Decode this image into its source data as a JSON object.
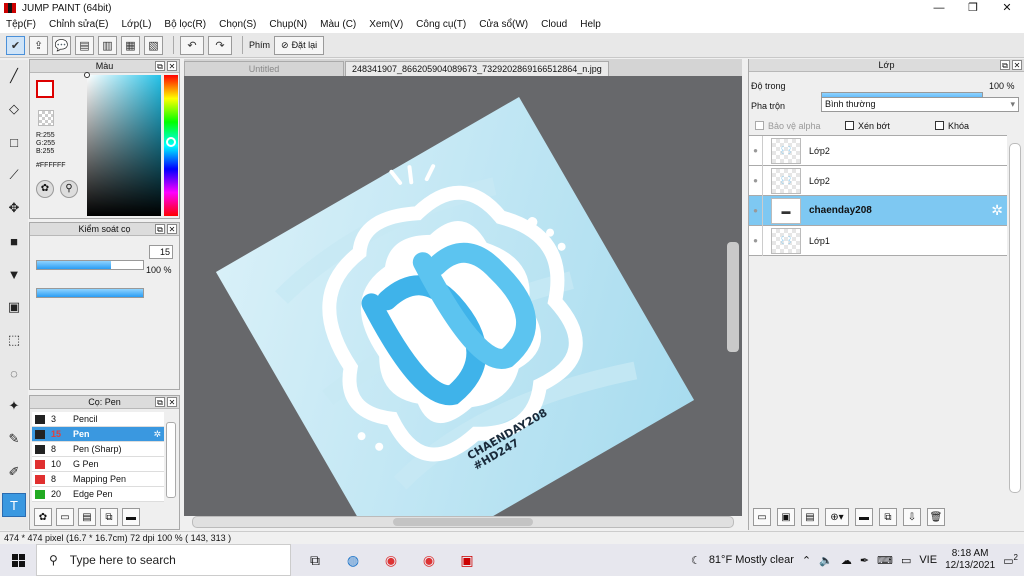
{
  "title": "JUMP PAINT (64bit)",
  "window_controls": {
    "minimize": "—",
    "maximize": "❐",
    "close": "✕"
  },
  "menu": [
    "Tệp(F)",
    "Chỉnh sửa(E)",
    "Lớp(L)",
    "Bộ lọc(R)",
    "Chọn(S)",
    "Chụp(N)",
    "Màu (C)",
    "Xem(V)",
    "Công cụ(T)",
    "Cửa sổ(W)",
    "Cloud",
    "Help"
  ],
  "toolbar": {
    "phim_label": "Phím",
    "reset_label": "Đặt lại"
  },
  "color_panel": {
    "title": "Màu",
    "r": "R:255",
    "g": "G:255",
    "b": "B:255",
    "hex": "#FFFFFF"
  },
  "brush_control": {
    "title": "Kiểm soát cọ",
    "size": "15",
    "opacity": "100 %",
    "size_fraction": 0.7,
    "opacity_fraction": 1.0
  },
  "brush_panel": {
    "title": "Cọ: Pen",
    "items": [
      {
        "size": "3",
        "name": "Pencil",
        "color": "#222222"
      },
      {
        "size": "15",
        "name": "Pen",
        "color": "#222222"
      },
      {
        "size": "8",
        "name": "Pen (Sharp)",
        "color": "#222222"
      },
      {
        "size": "10",
        "name": "G Pen",
        "color": "#e03030"
      },
      {
        "size": "8",
        "name": "Mapping Pen",
        "color": "#e03030"
      },
      {
        "size": "20",
        "name": "Edge Pen",
        "color": "#22aa22"
      }
    ]
  },
  "tabs": {
    "untitled": "Untitled",
    "file": "248341907_866205904089673_7329202869166512864_n.jpg"
  },
  "artwork_text": {
    "line1": "CHAENDAY208",
    "line2": "#HD247"
  },
  "layer_panel": {
    "title": "Lớp",
    "opacity_label": "Độ trong",
    "opacity_value": "100 %",
    "blend_label": "Pha trộn",
    "blend_value": "Bình thường",
    "protect_alpha": "Bảo vệ alpha",
    "clipping": "Xén bớt",
    "lock": "Khóa",
    "layers": [
      {
        "name": "Lớp2",
        "selected": false
      },
      {
        "name": "Lớp2",
        "selected": false
      },
      {
        "name": "chaenday208",
        "selected": true
      },
      {
        "name": "Lớp1",
        "selected": false
      }
    ]
  },
  "status": "474 * 474 pixel  (16.7 * 16.7cm)  72 dpi  100 %  ( 143, 313 )",
  "taskbar": {
    "search_placeholder": "Type here to search",
    "weather": "81°F  Mostly clear",
    "lang": "VIE",
    "time": "8:18 AM",
    "date": "12/13/2021",
    "notifications": "2"
  }
}
